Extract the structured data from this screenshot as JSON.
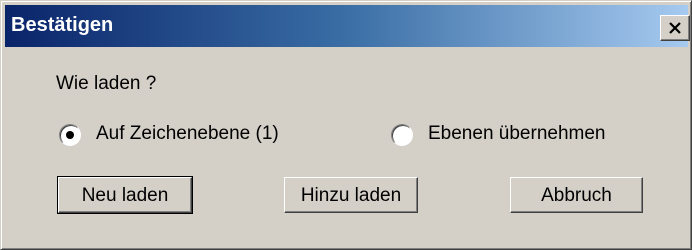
{
  "window": {
    "title": "Bestätigen",
    "close_label": "close"
  },
  "dialog": {
    "question": "Wie laden ?",
    "options": [
      {
        "label": "Auf Zeichenebene (1)",
        "selected": true
      },
      {
        "label": "Ebenen übernehmen",
        "selected": false
      }
    ],
    "buttons": {
      "neu_laden": "Neu laden",
      "hinzu_laden": "Hinzu laden",
      "abbruch": "Abbruch"
    }
  },
  "colors": {
    "face": "#d4d0c8",
    "titlebar_start": "#0a246a",
    "titlebar_end": "#a6caf0"
  }
}
